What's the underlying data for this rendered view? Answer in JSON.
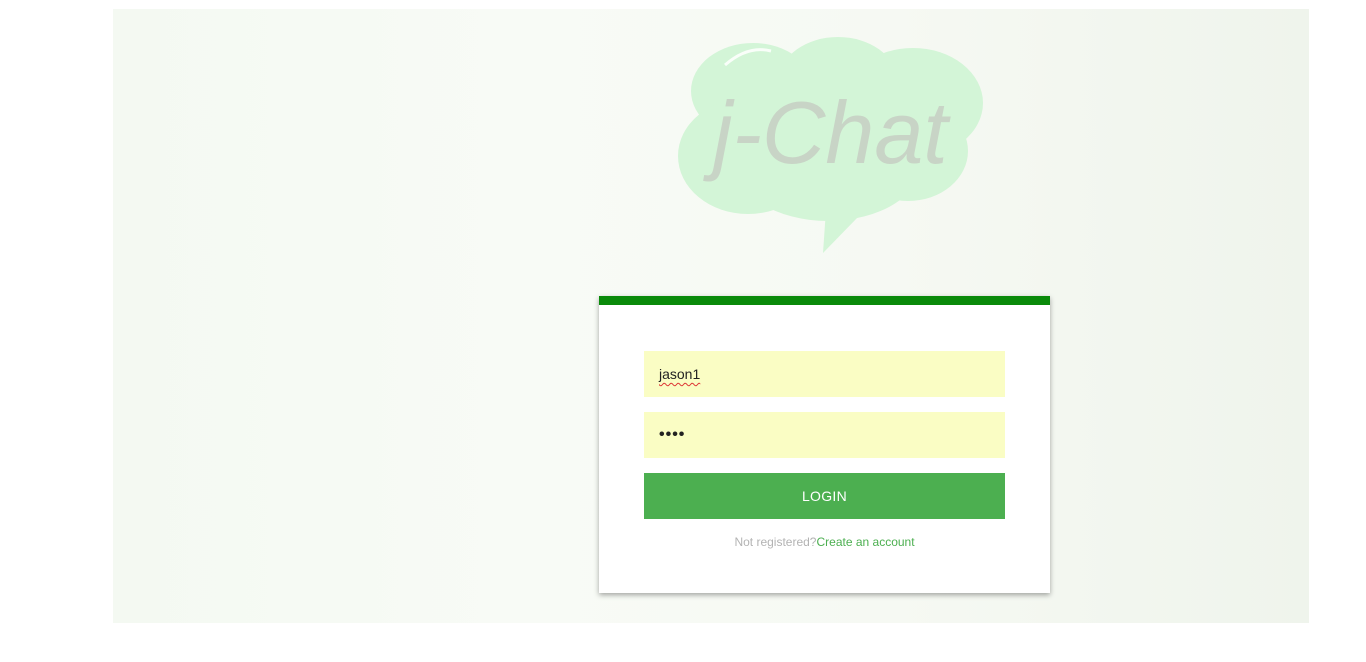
{
  "logo": {
    "text": "j-Chat",
    "bubble_color": "#d3f5d7",
    "text_color": "#c8d4c6"
  },
  "login_form": {
    "username_value": "jason1",
    "password_value": "••••",
    "login_label": "LOGIN",
    "register_prompt": "Not registered?",
    "register_link": "Create an account"
  },
  "colors": {
    "accent": "#0a8a0a",
    "button": "#4caf50",
    "field_background": "#fafdc4"
  }
}
